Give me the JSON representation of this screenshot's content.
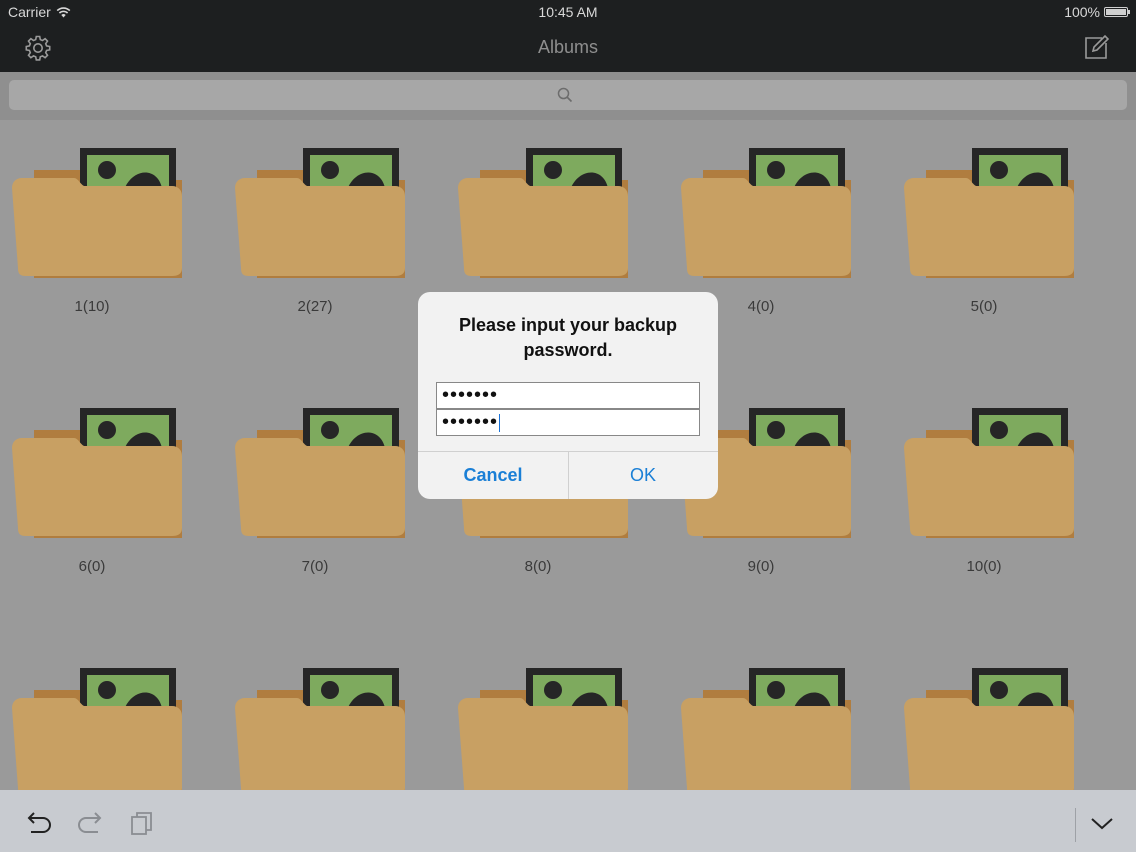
{
  "status_bar": {
    "carrier": "Carrier",
    "time": "10:45 AM",
    "battery": "100%",
    "battery_level": 1.0
  },
  "nav_bar": {
    "title": "Albums",
    "left_icon": "gear-icon",
    "right_icon": "compose-icon"
  },
  "search": {
    "placeholder": "",
    "icon": "search-icon"
  },
  "albums": [
    {
      "label": "1(10)"
    },
    {
      "label": "2(27)"
    },
    {
      "label": ""
    },
    {
      "label": "4(0)"
    },
    {
      "label": "5(0)"
    },
    {
      "label": "6(0)"
    },
    {
      "label": "7(0)"
    },
    {
      "label": "8(0)"
    },
    {
      "label": "9(0)"
    },
    {
      "label": "10(0)"
    },
    {
      "label": ""
    },
    {
      "label": ""
    },
    {
      "label": ""
    },
    {
      "label": ""
    },
    {
      "label": ""
    }
  ],
  "dialog": {
    "message": "Please input your backup password.",
    "password_field": "•••••••",
    "confirm_field": "•••••••",
    "cancel_label": "Cancel",
    "ok_label": "OK"
  },
  "bottom_bar": {
    "undo_icon": "undo-icon",
    "redo_icon": "redo-icon",
    "paste_icon": "paste-icon",
    "dismiss_icon": "chevron-down-icon"
  },
  "colors": {
    "folder": "#c8a063",
    "photo_bg": "#7eaa5e",
    "accent": "#1a7fd6"
  }
}
